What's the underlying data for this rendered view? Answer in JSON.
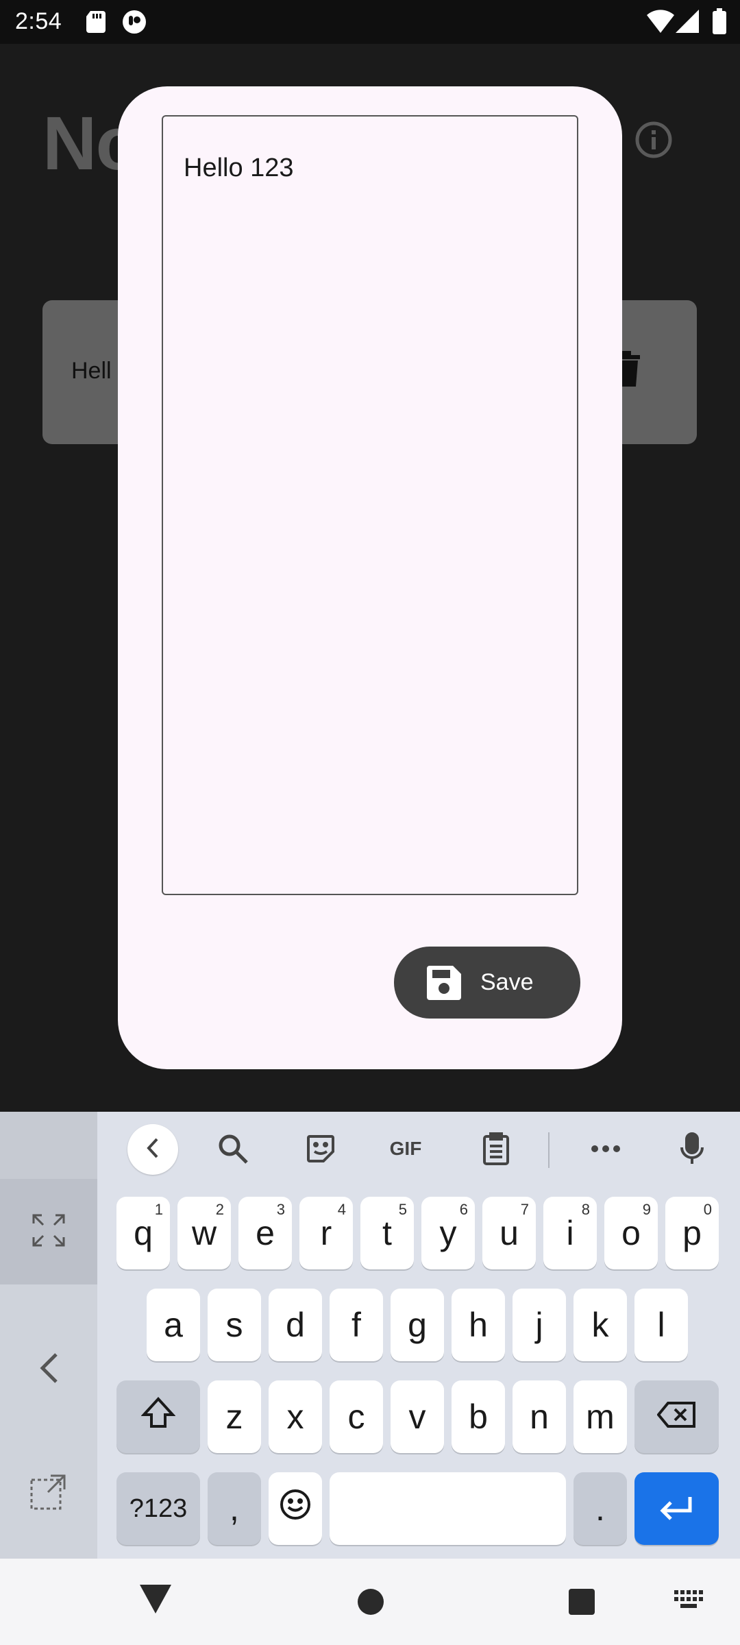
{
  "status_bar": {
    "time": "2:54"
  },
  "background_app": {
    "title": "No",
    "note_card_text": "Hell"
  },
  "dialog": {
    "note_text": "Hello 123",
    "save_label": "Save"
  },
  "keyboard": {
    "toolbar": {
      "gif_label": "GIF"
    },
    "row1": [
      {
        "key": "q",
        "num": "1"
      },
      {
        "key": "w",
        "num": "2"
      },
      {
        "key": "e",
        "num": "3"
      },
      {
        "key": "r",
        "num": "4"
      },
      {
        "key": "t",
        "num": "5"
      },
      {
        "key": "y",
        "num": "6"
      },
      {
        "key": "u",
        "num": "7"
      },
      {
        "key": "i",
        "num": "8"
      },
      {
        "key": "o",
        "num": "9"
      },
      {
        "key": "p",
        "num": "0"
      }
    ],
    "row2": [
      "a",
      "s",
      "d",
      "f",
      "g",
      "h",
      "j",
      "k",
      "l"
    ],
    "row3": [
      "z",
      "x",
      "c",
      "v",
      "b",
      "n",
      "m"
    ],
    "row4": {
      "symbols": "?123",
      "comma": ",",
      "period": "."
    }
  },
  "colors": {
    "accent": "#1a73e8",
    "dialog_bg": "#fdf5fc",
    "save_button": "#404040"
  }
}
